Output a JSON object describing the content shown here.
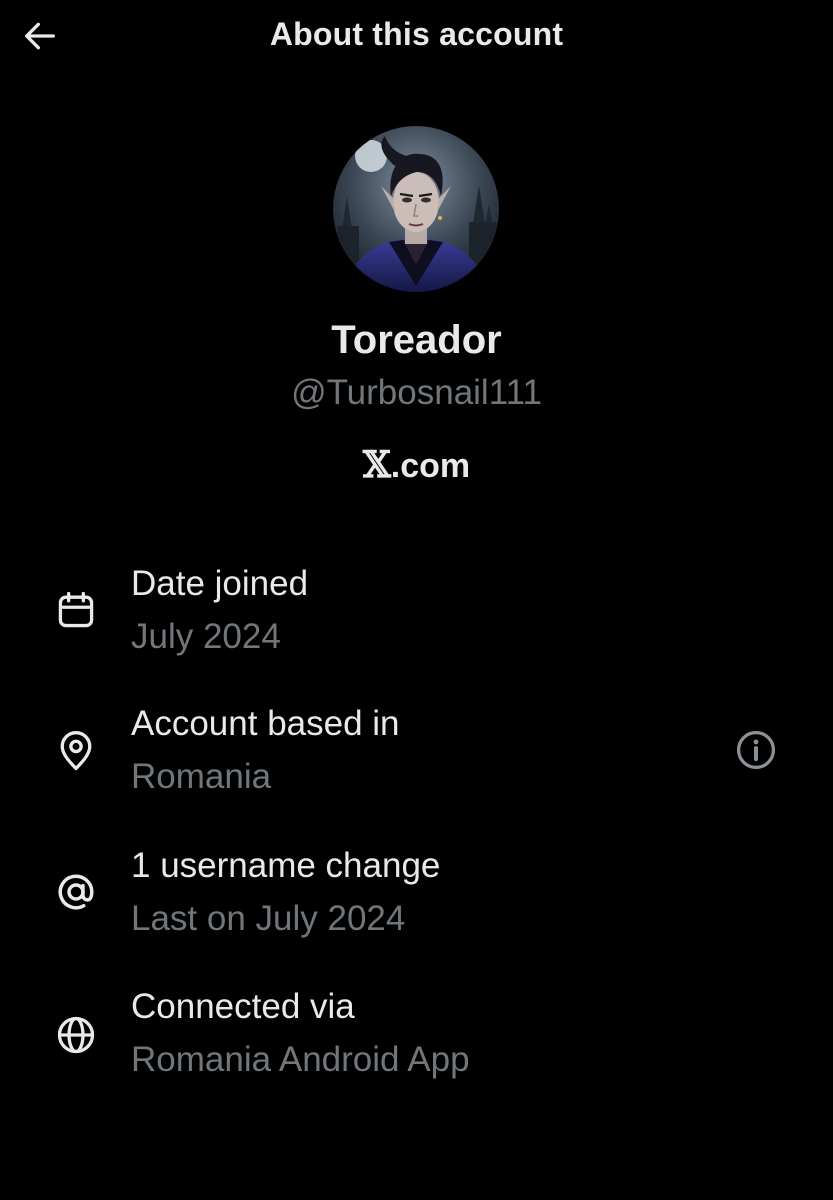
{
  "header": {
    "title": "About this account",
    "back_icon": "arrow-left-icon"
  },
  "profile": {
    "display_name": "Toreador",
    "handle": "@Turbosnail111",
    "site_mark": "𝕏",
    "site_suffix": ".com"
  },
  "rows": [
    {
      "icon": "calendar-icon",
      "title": "Date joined",
      "subtitle": "July 2024"
    },
    {
      "icon": "location-pin-icon",
      "title": "Account based in",
      "subtitle": "Romania",
      "action_icon": "info-icon"
    },
    {
      "icon": "at-sign-icon",
      "title": "1 username change",
      "subtitle": "Last on July 2024"
    },
    {
      "icon": "globe-icon",
      "title": "Connected via",
      "subtitle": "Romania Android App"
    }
  ],
  "colors": {
    "background": "#000000",
    "primary_text": "#e7e9ea",
    "secondary_text": "#71767b"
  }
}
